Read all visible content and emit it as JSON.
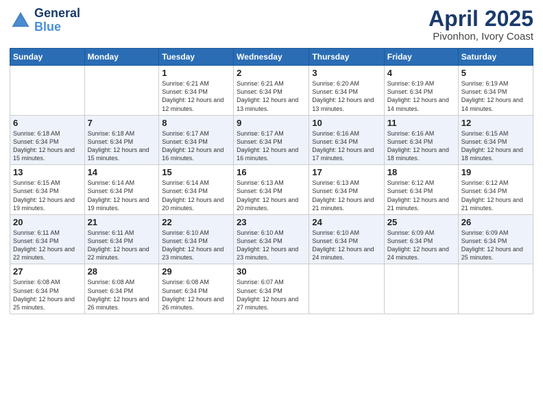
{
  "header": {
    "logo_line1": "General",
    "logo_line2": "Blue",
    "title": "April 2025",
    "subtitle": "Pivonhon, Ivory Coast"
  },
  "days_of_week": [
    "Sunday",
    "Monday",
    "Tuesday",
    "Wednesday",
    "Thursday",
    "Friday",
    "Saturday"
  ],
  "weeks": [
    [
      {
        "day": "",
        "sunrise": "",
        "sunset": "",
        "daylight": ""
      },
      {
        "day": "",
        "sunrise": "",
        "sunset": "",
        "daylight": ""
      },
      {
        "day": "1",
        "sunrise": "Sunrise: 6:21 AM",
        "sunset": "Sunset: 6:34 PM",
        "daylight": "Daylight: 12 hours and 12 minutes."
      },
      {
        "day": "2",
        "sunrise": "Sunrise: 6:21 AM",
        "sunset": "Sunset: 6:34 PM",
        "daylight": "Daylight: 12 hours and 13 minutes."
      },
      {
        "day": "3",
        "sunrise": "Sunrise: 6:20 AM",
        "sunset": "Sunset: 6:34 PM",
        "daylight": "Daylight: 12 hours and 13 minutes."
      },
      {
        "day": "4",
        "sunrise": "Sunrise: 6:19 AM",
        "sunset": "Sunset: 6:34 PM",
        "daylight": "Daylight: 12 hours and 14 minutes."
      },
      {
        "day": "5",
        "sunrise": "Sunrise: 6:19 AM",
        "sunset": "Sunset: 6:34 PM",
        "daylight": "Daylight: 12 hours and 14 minutes."
      }
    ],
    [
      {
        "day": "6",
        "sunrise": "Sunrise: 6:18 AM",
        "sunset": "Sunset: 6:34 PM",
        "daylight": "Daylight: 12 hours and 15 minutes."
      },
      {
        "day": "7",
        "sunrise": "Sunrise: 6:18 AM",
        "sunset": "Sunset: 6:34 PM",
        "daylight": "Daylight: 12 hours and 15 minutes."
      },
      {
        "day": "8",
        "sunrise": "Sunrise: 6:17 AM",
        "sunset": "Sunset: 6:34 PM",
        "daylight": "Daylight: 12 hours and 16 minutes."
      },
      {
        "day": "9",
        "sunrise": "Sunrise: 6:17 AM",
        "sunset": "Sunset: 6:34 PM",
        "daylight": "Daylight: 12 hours and 16 minutes."
      },
      {
        "day": "10",
        "sunrise": "Sunrise: 6:16 AM",
        "sunset": "Sunset: 6:34 PM",
        "daylight": "Daylight: 12 hours and 17 minutes."
      },
      {
        "day": "11",
        "sunrise": "Sunrise: 6:16 AM",
        "sunset": "Sunset: 6:34 PM",
        "daylight": "Daylight: 12 hours and 18 minutes."
      },
      {
        "day": "12",
        "sunrise": "Sunrise: 6:15 AM",
        "sunset": "Sunset: 6:34 PM",
        "daylight": "Daylight: 12 hours and 18 minutes."
      }
    ],
    [
      {
        "day": "13",
        "sunrise": "Sunrise: 6:15 AM",
        "sunset": "Sunset: 6:34 PM",
        "daylight": "Daylight: 12 hours and 19 minutes."
      },
      {
        "day": "14",
        "sunrise": "Sunrise: 6:14 AM",
        "sunset": "Sunset: 6:34 PM",
        "daylight": "Daylight: 12 hours and 19 minutes."
      },
      {
        "day": "15",
        "sunrise": "Sunrise: 6:14 AM",
        "sunset": "Sunset: 6:34 PM",
        "daylight": "Daylight: 12 hours and 20 minutes."
      },
      {
        "day": "16",
        "sunrise": "Sunrise: 6:13 AM",
        "sunset": "Sunset: 6:34 PM",
        "daylight": "Daylight: 12 hours and 20 minutes."
      },
      {
        "day": "17",
        "sunrise": "Sunrise: 6:13 AM",
        "sunset": "Sunset: 6:34 PM",
        "daylight": "Daylight: 12 hours and 21 minutes."
      },
      {
        "day": "18",
        "sunrise": "Sunrise: 6:12 AM",
        "sunset": "Sunset: 6:34 PM",
        "daylight": "Daylight: 12 hours and 21 minutes."
      },
      {
        "day": "19",
        "sunrise": "Sunrise: 6:12 AM",
        "sunset": "Sunset: 6:34 PM",
        "daylight": "Daylight: 12 hours and 21 minutes."
      }
    ],
    [
      {
        "day": "20",
        "sunrise": "Sunrise: 6:11 AM",
        "sunset": "Sunset: 6:34 PM",
        "daylight": "Daylight: 12 hours and 22 minutes."
      },
      {
        "day": "21",
        "sunrise": "Sunrise: 6:11 AM",
        "sunset": "Sunset: 6:34 PM",
        "daylight": "Daylight: 12 hours and 22 minutes."
      },
      {
        "day": "22",
        "sunrise": "Sunrise: 6:10 AM",
        "sunset": "Sunset: 6:34 PM",
        "daylight": "Daylight: 12 hours and 23 minutes."
      },
      {
        "day": "23",
        "sunrise": "Sunrise: 6:10 AM",
        "sunset": "Sunset: 6:34 PM",
        "daylight": "Daylight: 12 hours and 23 minutes."
      },
      {
        "day": "24",
        "sunrise": "Sunrise: 6:10 AM",
        "sunset": "Sunset: 6:34 PM",
        "daylight": "Daylight: 12 hours and 24 minutes."
      },
      {
        "day": "25",
        "sunrise": "Sunrise: 6:09 AM",
        "sunset": "Sunset: 6:34 PM",
        "daylight": "Daylight: 12 hours and 24 minutes."
      },
      {
        "day": "26",
        "sunrise": "Sunrise: 6:09 AM",
        "sunset": "Sunset: 6:34 PM",
        "daylight": "Daylight: 12 hours and 25 minutes."
      }
    ],
    [
      {
        "day": "27",
        "sunrise": "Sunrise: 6:08 AM",
        "sunset": "Sunset: 6:34 PM",
        "daylight": "Daylight: 12 hours and 25 minutes."
      },
      {
        "day": "28",
        "sunrise": "Sunrise: 6:08 AM",
        "sunset": "Sunset: 6:34 PM",
        "daylight": "Daylight: 12 hours and 26 minutes."
      },
      {
        "day": "29",
        "sunrise": "Sunrise: 6:08 AM",
        "sunset": "Sunset: 6:34 PM",
        "daylight": "Daylight: 12 hours and 26 minutes."
      },
      {
        "day": "30",
        "sunrise": "Sunrise: 6:07 AM",
        "sunset": "Sunset: 6:34 PM",
        "daylight": "Daylight: 12 hours and 27 minutes."
      },
      {
        "day": "",
        "sunrise": "",
        "sunset": "",
        "daylight": ""
      },
      {
        "day": "",
        "sunrise": "",
        "sunset": "",
        "daylight": ""
      },
      {
        "day": "",
        "sunrise": "",
        "sunset": "",
        "daylight": ""
      }
    ]
  ]
}
